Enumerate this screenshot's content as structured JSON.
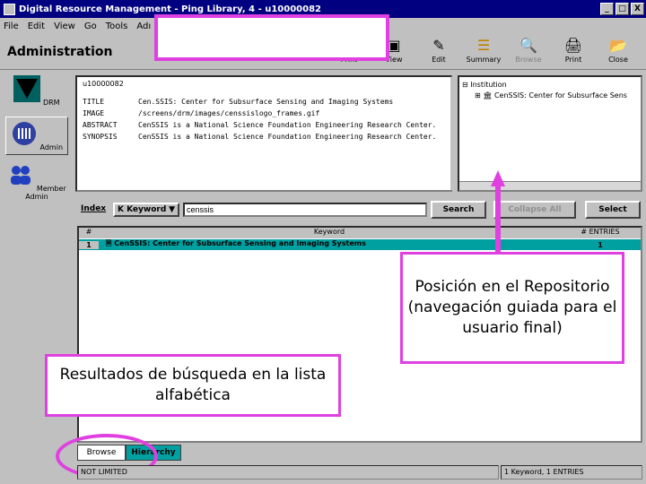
{
  "window": {
    "title": "Digital Resource Management - Ping Library, 4 - u10000082",
    "min": "_",
    "max": "□",
    "close": "X"
  },
  "menu": [
    "File",
    "Edit",
    "View",
    "Go",
    "Tools",
    "Adı"
  ],
  "header": {
    "title": "Administration"
  },
  "toolbar": [
    {
      "label": "Print",
      "icon": "printer-icon"
    },
    {
      "label": "View",
      "icon": "view-icon"
    },
    {
      "label": "Edit",
      "icon": "edit-icon"
    },
    {
      "label": "Summary",
      "icon": "summary-icon"
    },
    {
      "label": "Browse",
      "icon": "browse-icon"
    },
    {
      "label": "Print",
      "icon": "print-icon"
    },
    {
      "label": "Close",
      "icon": "close-folder-icon"
    }
  ],
  "sidebar": [
    {
      "label": "DRM",
      "icon": "drm-icon"
    },
    {
      "label": "Admin",
      "icon": "admin-icon"
    },
    {
      "label": "Member Admin",
      "icon": "member-admin-icon"
    }
  ],
  "record": {
    "id": "u10000082",
    "rows": [
      {
        "key": "TITLE",
        "value": "Cen.SSIS: Center for Subsurface Sensing and Imaging Systems"
      },
      {
        "key": "IMAGE",
        "value": "/screens/drm/images/censsislogo_frames.gif"
      },
      {
        "key": "ABSTRACT",
        "value": "CenSSIS is a National Science Foundation Engineering Research Center."
      },
      {
        "key": "SYNOPSIS",
        "value": "CenSSIS is a National Science Foundation Engineering Research Center."
      }
    ]
  },
  "tree": {
    "root": "Institution",
    "child": "CenSSIS: Center for Subsurface Sens"
  },
  "search": {
    "index_label": "Index",
    "index_value": "K Keyword",
    "query": "censsis",
    "search_btn": "Search",
    "collapse_btn": "Collapse All",
    "select_btn": "Select"
  },
  "results": {
    "headers": [
      "#",
      "Keyword",
      "# ENTRIES"
    ],
    "rows": [
      {
        "num": "1",
        "keyword": "CenSSIS: Center for Subsurface Sensing and Imaging Systems",
        "entries": "1"
      }
    ]
  },
  "callouts": {
    "repo": "Posición en el Repositorio (navegación guiada para el usuario final)",
    "results": "Resultados de búsqueda en la lista alfabética"
  },
  "tabs": [
    "Browse",
    "Hierarchy"
  ],
  "status": {
    "left": "NOT LIMITED",
    "right": "1 Keyword, 1 ENTRIES"
  },
  "colors": {
    "annotation": "#e040e0",
    "titlebar": "#000080",
    "selection": "#00a0a0"
  }
}
